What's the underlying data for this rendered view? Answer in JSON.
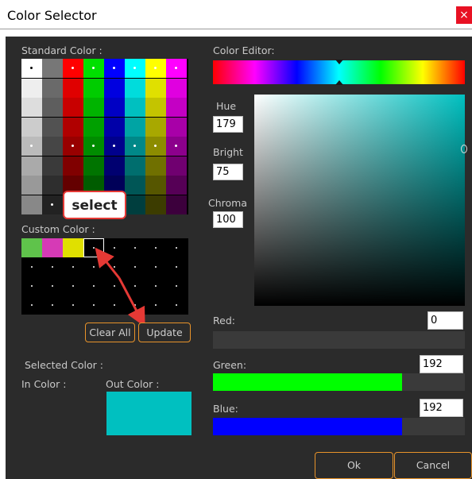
{
  "window": {
    "title": "Color Selector",
    "close_glyph": "×"
  },
  "standard": {
    "label": "Standard Color :",
    "columns": [
      [
        "#ffffff",
        "#eeeeee",
        "#dddddd",
        "#cccccc",
        "#bbbbbb",
        "#aaaaaa",
        "#999999",
        "#888888"
      ],
      [
        "#777777",
        "#6a6a6a",
        "#5e5e5e",
        "#525252",
        "#464646",
        "#3a3a3a",
        "#2e2e2e",
        "#222222"
      ],
      [
        "#ff0000",
        "#e00000",
        "#c80000",
        "#b00000",
        "#980000",
        "#800000",
        "#640000",
        "#4a0000"
      ],
      [
        "#00e000",
        "#00cc00",
        "#00b400",
        "#00a000",
        "#008c00",
        "#007400",
        "#005c00",
        "#004600"
      ],
      [
        "#0000ff",
        "#0000e0",
        "#0000c4",
        "#0000a8",
        "#00008c",
        "#000070",
        "#000058",
        "#000040"
      ],
      [
        "#00ffff",
        "#00dcdc",
        "#00c0c0",
        "#00a4a4",
        "#008888",
        "#006e6e",
        "#005656",
        "#003e3e"
      ],
      [
        "#ffff00",
        "#e0e000",
        "#c4c400",
        "#a8a800",
        "#8c8c00",
        "#707000",
        "#565600",
        "#3c3c00"
      ],
      [
        "#ff00ff",
        "#e000e0",
        "#c400c4",
        "#a800a8",
        "#8c008c",
        "#700070",
        "#560056",
        "#3c003c"
      ]
    ],
    "dots": [
      [
        0,
        0
      ],
      [
        2,
        0
      ],
      [
        3,
        0
      ],
      [
        4,
        0
      ],
      [
        5,
        0
      ],
      [
        6,
        0
      ],
      [
        7,
        0
      ],
      [
        0,
        4
      ],
      [
        2,
        4
      ],
      [
        3,
        4
      ],
      [
        4,
        4
      ],
      [
        5,
        4
      ],
      [
        6,
        4
      ],
      [
        7,
        4
      ],
      [
        1,
        7
      ]
    ]
  },
  "callout": {
    "text": "select"
  },
  "custom": {
    "label": "Custom Color :",
    "swatches": [
      "#5fc34b",
      "#d63ab6",
      "#e0e000",
      "#000000"
    ]
  },
  "buttons": {
    "clear_all": "Clear All",
    "update": "Update",
    "ok": "Ok",
    "cancel": "Cancel"
  },
  "selected": {
    "label": "Selected Color :",
    "in_label": "In Color :",
    "out_label": "Out Color :",
    "out_color": "#00c0c0"
  },
  "editor": {
    "label": "Color Editor:",
    "hue_label": "Hue",
    "hue_value": "179",
    "bright_label": "Bright",
    "bright_value": "75",
    "chroma_label": "Chroma",
    "chroma_value": "100",
    "red_label": "Red:",
    "red_value": "0",
    "red_fill_fraction": 0.0,
    "red_color": "#ff0000",
    "green_label": "Green:",
    "green_value": "192",
    "green_fill_fraction": 0.75,
    "green_color": "#00ff00",
    "blue_label": "Blue:",
    "blue_value": "192",
    "blue_fill_fraction": 0.75,
    "blue_color": "#0000ff"
  }
}
